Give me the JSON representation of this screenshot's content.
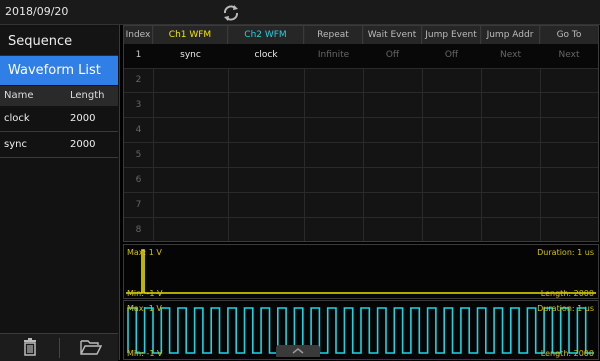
{
  "topbar": {
    "date": "2018/09/20"
  },
  "sidebar": {
    "sequence_label": "Sequence",
    "waveform_list_label": "Waveform List",
    "col_name": "Name",
    "col_length": "Length",
    "rows": [
      {
        "name": "clock",
        "length": "2000"
      },
      {
        "name": "sync",
        "length": "2000"
      }
    ]
  },
  "table": {
    "headers": [
      "Index",
      "Ch1 WFM",
      "Ch2 WFM",
      "Repeat",
      "Wait Event",
      "Jump Event",
      "Jump Addr",
      "Go To"
    ],
    "row1": [
      "1",
      "sync",
      "clock",
      "Infinite",
      "Off",
      "Off",
      "Next",
      "Next"
    ],
    "row_indices": [
      "2",
      "3",
      "4",
      "5",
      "6",
      "7",
      "8"
    ]
  },
  "wave1": {
    "max": "Max: 1 V",
    "min": "Min: -1 V",
    "duration": "Duration: 1 us",
    "length": "Length: 2000"
  },
  "wave2": {
    "max": "Max: 1 V",
    "min": "Min: -1 V",
    "duration": "Duration: 1 us",
    "length": "Length: 2000"
  },
  "colors": {
    "ch1": "#f2e200",
    "ch2": "#22cfe0",
    "accent": "#2f7fe6",
    "yellow_wave": "#e8e100",
    "cyan_wave": "#1ad6e3"
  }
}
